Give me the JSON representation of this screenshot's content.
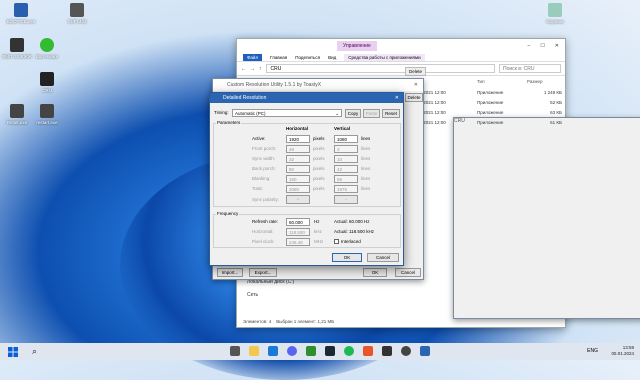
{
  "desktop": {
    "icons_left": [
      {
        "label": "BOOTICE.exe"
      },
      {
        "label": "SHF1403"
      },
      {
        "label": "ЯМЛ 0.5ЖЖЖ"
      },
      {
        "label": "BurnAware"
      },
      {
        "label": "CRU"
      },
      {
        "label": "Reset.exe"
      },
      {
        "label": "restart.exe"
      }
    ],
    "icons_right": [
      {
        "label": "Корзина"
      },
      {
        "label": "Программы"
      },
      {
        "label": "Панель управления"
      },
      {
        "label": "СТОУ"
      }
    ]
  },
  "explorer": {
    "ribbon_tab_highlight": "Управление",
    "folder_title": "CRU",
    "ribbon_tabs": [
      "Файл",
      "Главная",
      "Поделиться",
      "Вид",
      "Средства работы с приложениями"
    ],
    "address": "CRU",
    "search_placeholder": "Поиск в: CRU",
    "columns": [
      "Тип",
      "Размер"
    ],
    "rows": [
      {
        "date": "01.2021 12:00",
        "type": "Приложение",
        "size": "1 249 КБ"
      },
      {
        "date": "01.2021 12:00",
        "type": "Приложение",
        "size": "52 КБ"
      },
      {
        "date": "01.2021 12:00",
        "type": "Приложение",
        "size": "63 КБ"
      },
      {
        "date": "01.2021 12:00",
        "type": "Приложение",
        "size": "61 КБ"
      }
    ],
    "delete_label": "Delete",
    "nav_items": [
      "Локальный диск (C:)",
      "Сеть"
    ],
    "status_items": "Элементов: 4",
    "status_selected": "Выбран 1 элемент: 1,21 МБ"
  },
  "cru": {
    "title": "Custom Resolution Utility 1.5.1 by ToastyX",
    "monitor": "SHF1403",
    "established_label": "Establis",
    "res_items": [
      "640x",
      "640x",
      "640x",
      "800x",
      "800x",
      "800x",
      "800x",
      "1024",
      "1024",
      "1024",
      "1280"
    ],
    "group_labels": [
      "640",
      "800",
      "102",
      "128"
    ],
    "all_label": "All",
    "delete_label": "Delete",
    "import_label": "Import...",
    "export_label": "Export...",
    "ok_label": "OK",
    "cancel_label": "Cancel"
  },
  "dialog": {
    "title": "Detailed Resolution",
    "timing_label": "Timing:",
    "timing_value": "Automatic (PC)",
    "copy_label": "Copy",
    "paste_label": "Paste",
    "reset_label": "Reset",
    "parameters_label": "Parameters",
    "horizontal_label": "Horizontal",
    "vertical_label": "Vertical",
    "rows": [
      {
        "label": "Active:",
        "h": "1920",
        "hu": "pixels",
        "v": "1080",
        "vu": "lines",
        "enabled": true
      },
      {
        "label": "Front porch:",
        "h": "48",
        "hu": "pixels",
        "v": "3",
        "vu": "lines",
        "enabled": false
      },
      {
        "label": "Sync width:",
        "h": "32",
        "hu": "pixels",
        "v": "10",
        "vu": "lines",
        "enabled": false
      },
      {
        "label": "Back porch:",
        "h": "80",
        "hu": "pixels",
        "v": "42",
        "vu": "lines",
        "enabled": false
      },
      {
        "label": "Blanking:",
        "h": "160",
        "hu": "pixels",
        "v": "55",
        "vu": "lines",
        "enabled": false
      },
      {
        "label": "Total:",
        "h": "2080",
        "hu": "pixels",
        "v": "1975",
        "vu": "lines",
        "enabled": false
      }
    ],
    "sync_polarity_label": "Sync polarity:",
    "h_polarity": "+",
    "v_polarity": "−",
    "frequency_label": "Frequency",
    "refresh_label": "Refresh rate:",
    "refresh_value": "60.000",
    "refresh_unit": "Hz",
    "refresh_actual": "Actual: 60.000 Hz",
    "horizontal_freq_label": "Horizontal:",
    "horizontal_freq_value": "118.500",
    "horizontal_freq_unit": "kHz",
    "horizontal_actual": "Actual: 118.500 kHz",
    "pixel_clock_label": "Pixel clock:",
    "pixel_clock_value": "246.48",
    "pixel_clock_unit": "MHz",
    "interlaced_label": "Interlaced",
    "ok_label": "OK",
    "cancel_label": "Cancel"
  },
  "taskbar": {
    "lang": "ENG",
    "time": "13:59",
    "date": "05.01.2024"
  }
}
